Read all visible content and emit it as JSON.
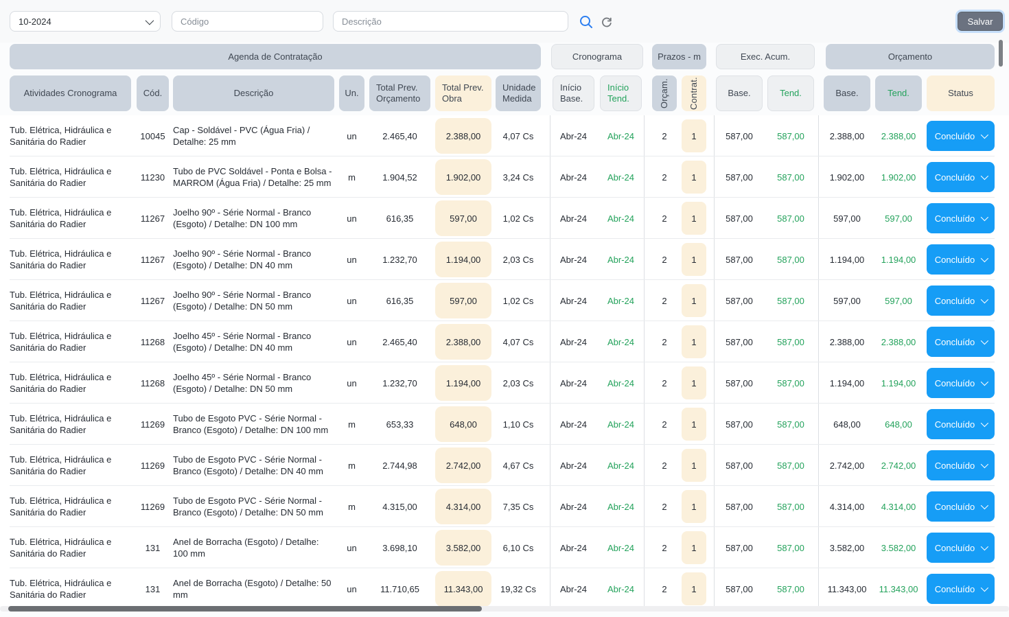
{
  "toolbar": {
    "period_value": "10-2024",
    "codigo_placeholder": "Código",
    "descricao_placeholder": "Descrição",
    "save_label": "Salvar"
  },
  "colors": {
    "accent_blue": "#169df6",
    "green": "#23a25b",
    "header_blue_gray": "#ccd4de",
    "header_light_gray": "#eef0f2",
    "cream": "#fbf0db",
    "save_gray": "#6b7280"
  },
  "table": {
    "groups": [
      "Agenda de Contratação",
      "Cronograma",
      "Prazos - m",
      "Exec. Acum.",
      "Orçamento"
    ],
    "columns": [
      "Atividades Cronograma",
      "Cód.",
      "Descrição",
      "Un.",
      "Total Prev. Orçamento",
      "Total Prev. Obra",
      "Unidade Medida",
      "Início Base.",
      "Início Tend.",
      "Orçam.",
      "Contrat.",
      "Base.",
      "Tend.",
      "Base.",
      "Tend.",
      "Status"
    ],
    "rows": [
      {
        "activity": "Tub. Elétrica, Hidráulica e Sanitária do Radier",
        "code": "10045",
        "description": "Cap - Soldável - PVC (Água Fria) / Detalhe: 25 mm",
        "unit": "un",
        "total_prev_orcamento": "2.465,40",
        "total_prev_obra": "2.388,00",
        "unidade_medida": "4,07 Cs",
        "inicio_base": "Abr-24",
        "inicio_tend": "Abr-24",
        "orcam": "2",
        "contrat": "1",
        "exec_base": "587,00",
        "exec_tend": "587,00",
        "orc_base": "2.388,00",
        "orc_tend": "2.388,00",
        "status": "Concluído"
      },
      {
        "activity": "Tub. Elétrica, Hidráulica e Sanitária do Radier",
        "code": "11230",
        "description": "Tubo de PVC Soldável - Ponta e Bolsa - MARROM (Água Fria) / Detalhe: 25 mm",
        "unit": "m",
        "total_prev_orcamento": "1.904,52",
        "total_prev_obra": "1.902,00",
        "unidade_medida": "3,24 Cs",
        "inicio_base": "Abr-24",
        "inicio_tend": "Abr-24",
        "orcam": "2",
        "contrat": "1",
        "exec_base": "587,00",
        "exec_tend": "587,00",
        "orc_base": "1.902,00",
        "orc_tend": "1.902,00",
        "status": "Concluído"
      },
      {
        "activity": "Tub. Elétrica, Hidráulica e Sanitária do Radier",
        "code": "11267",
        "description": "Joelho 90º - Série Normal - Branco (Esgoto) / Detalhe: DN 100 mm",
        "unit": "un",
        "total_prev_orcamento": "616,35",
        "total_prev_obra": "597,00",
        "unidade_medida": "1,02 Cs",
        "inicio_base": "Abr-24",
        "inicio_tend": "Abr-24",
        "orcam": "2",
        "contrat": "1",
        "exec_base": "587,00",
        "exec_tend": "587,00",
        "orc_base": "597,00",
        "orc_tend": "597,00",
        "status": "Concluído"
      },
      {
        "activity": "Tub. Elétrica, Hidráulica e Sanitária do Radier",
        "code": "11267",
        "description": "Joelho 90º - Série Normal - Branco (Esgoto) / Detalhe: DN 40 mm",
        "unit": "un",
        "total_prev_orcamento": "1.232,70",
        "total_prev_obra": "1.194,00",
        "unidade_medida": "2,03 Cs",
        "inicio_base": "Abr-24",
        "inicio_tend": "Abr-24",
        "orcam": "2",
        "contrat": "1",
        "exec_base": "587,00",
        "exec_tend": "587,00",
        "orc_base": "1.194,00",
        "orc_tend": "1.194,00",
        "status": "Concluído"
      },
      {
        "activity": "Tub. Elétrica, Hidráulica e Sanitária do Radier",
        "code": "11267",
        "description": "Joelho 90º - Série Normal - Branco (Esgoto) / Detalhe: DN 50 mm",
        "unit": "un",
        "total_prev_orcamento": "616,35",
        "total_prev_obra": "597,00",
        "unidade_medida": "1,02 Cs",
        "inicio_base": "Abr-24",
        "inicio_tend": "Abr-24",
        "orcam": "2",
        "contrat": "1",
        "exec_base": "587,00",
        "exec_tend": "587,00",
        "orc_base": "597,00",
        "orc_tend": "597,00",
        "status": "Concluído"
      },
      {
        "activity": "Tub. Elétrica, Hidráulica e Sanitária do Radier",
        "code": "11268",
        "description": "Joelho 45º - Série Normal - Branco (Esgoto) / Detalhe: DN 40 mm",
        "unit": "un",
        "total_prev_orcamento": "2.465,40",
        "total_prev_obra": "2.388,00",
        "unidade_medida": "4,07 Cs",
        "inicio_base": "Abr-24",
        "inicio_tend": "Abr-24",
        "orcam": "2",
        "contrat": "1",
        "exec_base": "587,00",
        "exec_tend": "587,00",
        "orc_base": "2.388,00",
        "orc_tend": "2.388,00",
        "status": "Concluído"
      },
      {
        "activity": "Tub. Elétrica, Hidráulica e Sanitária do Radier",
        "code": "11268",
        "description": "Joelho 45º - Série Normal - Branco (Esgoto) / Detalhe: DN 50 mm",
        "unit": "un",
        "total_prev_orcamento": "1.232,70",
        "total_prev_obra": "1.194,00",
        "unidade_medida": "2,03 Cs",
        "inicio_base": "Abr-24",
        "inicio_tend": "Abr-24",
        "orcam": "2",
        "contrat": "1",
        "exec_base": "587,00",
        "exec_tend": "587,00",
        "orc_base": "1.194,00",
        "orc_tend": "1.194,00",
        "status": "Concluído"
      },
      {
        "activity": "Tub. Elétrica, Hidráulica e Sanitária do Radier",
        "code": "11269",
        "description": "Tubo de Esgoto PVC - Série Normal - Branco (Esgoto) / Detalhe: DN 100 mm",
        "unit": "m",
        "total_prev_orcamento": "653,33",
        "total_prev_obra": "648,00",
        "unidade_medida": "1,10 Cs",
        "inicio_base": "Abr-24",
        "inicio_tend": "Abr-24",
        "orcam": "2",
        "contrat": "1",
        "exec_base": "587,00",
        "exec_tend": "587,00",
        "orc_base": "648,00",
        "orc_tend": "648,00",
        "status": "Concluído"
      },
      {
        "activity": "Tub. Elétrica, Hidráulica e Sanitária do Radier",
        "code": "11269",
        "description": "Tubo de Esgoto PVC - Série Normal - Branco (Esgoto) / Detalhe: DN 40 mm",
        "unit": "m",
        "total_prev_orcamento": "2.744,98",
        "total_prev_obra": "2.742,00",
        "unidade_medida": "4,67 Cs",
        "inicio_base": "Abr-24",
        "inicio_tend": "Abr-24",
        "orcam": "2",
        "contrat": "1",
        "exec_base": "587,00",
        "exec_tend": "587,00",
        "orc_base": "2.742,00",
        "orc_tend": "2.742,00",
        "status": "Concluído"
      },
      {
        "activity": "Tub. Elétrica, Hidráulica e Sanitária do Radier",
        "code": "11269",
        "description": "Tubo de Esgoto PVC - Série Normal - Branco (Esgoto) / Detalhe: DN 50 mm",
        "unit": "m",
        "total_prev_orcamento": "4.315,00",
        "total_prev_obra": "4.314,00",
        "unidade_medida": "7,35 Cs",
        "inicio_base": "Abr-24",
        "inicio_tend": "Abr-24",
        "orcam": "2",
        "contrat": "1",
        "exec_base": "587,00",
        "exec_tend": "587,00",
        "orc_base": "4.314,00",
        "orc_tend": "4.314,00",
        "status": "Concluído"
      },
      {
        "activity": "Tub. Elétrica, Hidráulica e Sanitária do Radier",
        "code": "131",
        "description": "Anel de Borracha (Esgoto) / Detalhe: 100 mm",
        "unit": "un",
        "total_prev_orcamento": "3.698,10",
        "total_prev_obra": "3.582,00",
        "unidade_medida": "6,10 Cs",
        "inicio_base": "Abr-24",
        "inicio_tend": "Abr-24",
        "orcam": "2",
        "contrat": "1",
        "exec_base": "587,00",
        "exec_tend": "587,00",
        "orc_base": "3.582,00",
        "orc_tend": "3.582,00",
        "status": "Concluído"
      },
      {
        "activity": "Tub. Elétrica, Hidráulica e Sanitária do Radier",
        "code": "131",
        "description": "Anel de Borracha (Esgoto) / Detalhe: 50 mm",
        "unit": "un",
        "total_prev_orcamento": "11.710,65",
        "total_prev_obra": "11.343,00",
        "unidade_medida": "19,32 Cs",
        "inicio_base": "Abr-24",
        "inicio_tend": "Abr-24",
        "orcam": "2",
        "contrat": "1",
        "exec_base": "587,00",
        "exec_tend": "587,00",
        "orc_base": "11.343,00",
        "orc_tend": "11.343,00",
        "status": "Concluído"
      }
    ]
  }
}
